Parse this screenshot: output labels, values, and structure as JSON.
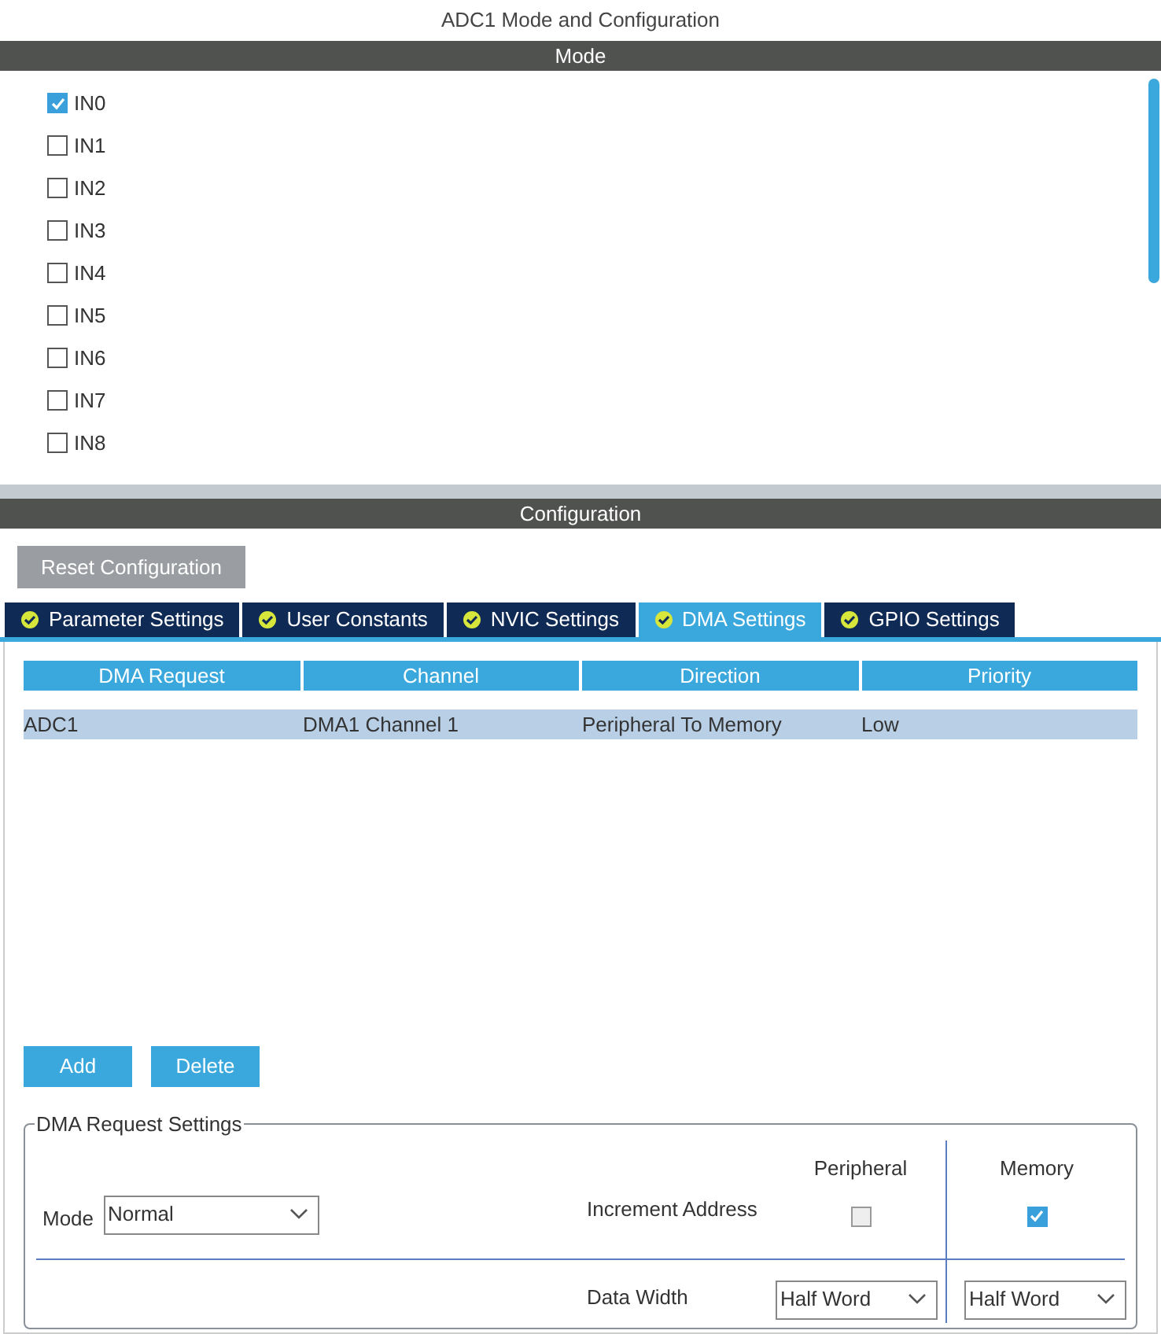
{
  "window": {
    "title": "ADC1 Mode and Configuration"
  },
  "mode": {
    "header": "Mode",
    "channels": [
      {
        "label": "IN0",
        "checked": true
      },
      {
        "label": "IN1",
        "checked": false
      },
      {
        "label": "IN2",
        "checked": false
      },
      {
        "label": "IN3",
        "checked": false
      },
      {
        "label": "IN4",
        "checked": false
      },
      {
        "label": "IN5",
        "checked": false
      },
      {
        "label": "IN6",
        "checked": false
      },
      {
        "label": "IN7",
        "checked": false
      },
      {
        "label": "IN8",
        "checked": false
      }
    ]
  },
  "configuration": {
    "header": "Configuration",
    "reset_button": "Reset Configuration",
    "tabs": [
      {
        "label": "Parameter Settings",
        "selected": false
      },
      {
        "label": "User Constants",
        "selected": false
      },
      {
        "label": "NVIC Settings",
        "selected": false
      },
      {
        "label": "DMA Settings",
        "selected": true
      },
      {
        "label": "GPIO Settings",
        "selected": false
      }
    ],
    "table": {
      "columns": [
        "DMA Request",
        "Channel",
        "Direction",
        "Priority"
      ],
      "rows": [
        {
          "cells": [
            "ADC1",
            "DMA1 Channel 1",
            "Peripheral To Memory",
            "Low"
          ],
          "selected": true
        }
      ]
    },
    "buttons": [
      "Add",
      "Delete"
    ],
    "request_settings": {
      "title": "DMA Request Settings",
      "mode_label": "Mode",
      "mode_value": "Normal",
      "peripheral_header": "Peripheral",
      "memory_header": "Memory",
      "increment_label": "Increment Address",
      "peripheral_increment": false,
      "memory_increment": true,
      "data_width_label": "Data Width",
      "peripheral_width": "Half Word",
      "memory_width": "Half Word"
    }
  }
}
